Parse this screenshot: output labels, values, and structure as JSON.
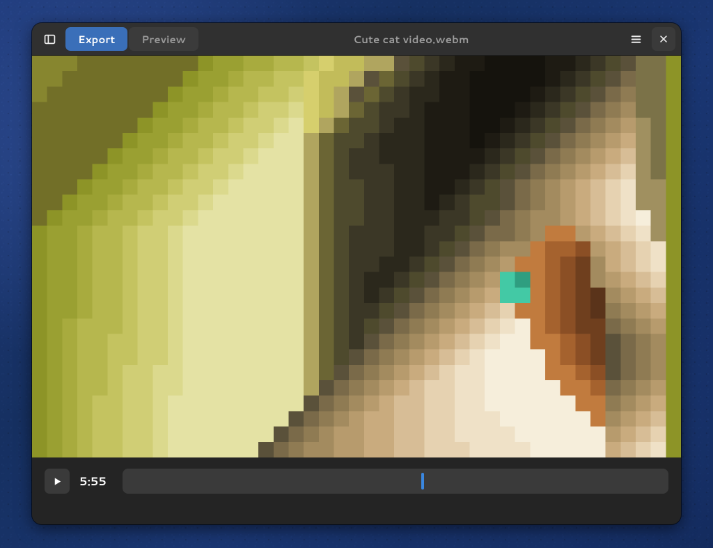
{
  "header": {
    "title": "Cute cat video.webm",
    "export_label": "Export",
    "preview_label": "Preview",
    "active_tab": "export"
  },
  "playback": {
    "time_label": "5:55",
    "progress_percent": 55
  },
  "icons": {
    "sidebar": "sidebar-toggle-icon",
    "menu": "hamburger-menu-icon",
    "close": "close-icon",
    "play": "play-icon"
  },
  "pixel_art": {
    "description": "pixelated tabby cat facing left on yellow-green bokeh background",
    "cols": 43,
    "rows": 26,
    "palette": {
      "A": "#8d9427",
      "B": "#9aa032",
      "C": "#a8ab3e",
      "D": "#b6b74e",
      "E": "#c4c360",
      "F": "#d0ce75",
      "G": "#dbd98d",
      "H": "#e4e2a4",
      "I": "#b0a55f",
      "J": "#6b6534",
      "K": "#4e4a2d",
      "L": "#3b3726",
      "M": "#2b281c",
      "N": "#1e1b13",
      "O": "#15130d",
      "P": "#5a513a",
      "Q": "#7a6a49",
      "R": "#8f7b53",
      "S": "#a38b5f",
      "T": "#b79b6d",
      "U": "#c9ab7e",
      "V": "#d7bd96",
      "W": "#e6d2b1",
      "X": "#efe1c7",
      "Y": "#f6eedb",
      "Z": "#c17b3e",
      "a": "#a5622e",
      "b": "#8b4f25",
      "c": "#6f3f1e",
      "d": "#5a331a",
      "e": "#43c9a5",
      "f": "#2f9e80",
      "g": "#d6cf6d",
      "h": "#c2bc5a",
      "i": "#5e5a30",
      "j": "#49462b",
      "k": "#383522",
      "l": "#9c9a40",
      "m": "#87862f",
      "n": "#726f28",
      "o": "#a09060",
      "p": "#7b7248"
    },
    "rows_data": [
      "mmmnnnnnnnnABBCCDDEghhIIPKLMNNOOOONNMLKPpp",
      "mmnnnnnnnnABBCDDEEghhIPJKLMNNOOOOONMLKPQpp",
      "mnnnnnnnnABBCDDEEFghIPJKLMMNNOOOONMLKPQRpp",
      "nnnnnnnnABBCDDEFFGghIJKLLMNNNOOONMLKPQRSpp",
      "nnnnnnnABBCDDEFFGHgIJKKLMMNNNOONMLKPQRSTop",
      "nnnnnnABBCDDEFFGHHIJKKLMMMNNNONMLKPQRSTUop",
      "nnnnnABBCDDEFFGHHHIJKLLMMMNNNNMLKPQRSTUVop",
      "nnnnABBCDDEFFGHHHHIJKLLLMMNNNMLKPQRSTUVWop",
      "nnnABBCDDEFFGHHHHHIJKKLLMMNNMLKPQRSTUVWXoo",
      "nnABBCDDEFFGHHHHHHIJKKLLMMNMLKKPQRSTUVWXoo",
      "nABBCDDEFFGHHHHHHHIJKKLLMMMLLKPQRSSTUVWXYo",
      "ABBCDDEFFGHHHHHHHHIJKLLLMMLLKPQQRSZZTUVWXo",
      "ABBCDDEFFGHHHHHHHHIJKLLLMMLKPQRSSZaabTUVWX",
      "ABBCDDEFFGHHHHHHHHIJKLLMMLKPQRSTZZabcSUVWX",
      "ABBCDDEFFGHHHHHHHHIJKLMMLKPQRSTefZabcSTUVW",
      "ABBCDDEFFGHHHHHHHHIJKLMLKPQRSTUeeZabcdSTUV",
      "ABBCDDEFFGHHHHHHHHIJKLLKPQRSTUVWZZabcdRSTU",
      "ABCDDDEFFGHHHHHHHHIJKLKPQRSTUVWXYZabccQRST",
      "ABCDDEEFFGHHHHHHHHIJKLPQRSTUVWXYYZZabcPQRS",
      "ABCDDEEFFGHHHHHHHHIJKPQRSTUVWXYYYYZabcPQRS",
      "ABCDDEFFGGHHHHHHHHIJPQRSTUVWXXYYYYZZabPQRS",
      "ABCDDEFFGGHHHHHHHHIPQRSTUVWWXXYYYYYZZaQRST",
      "ABCDEEFFGHHHHHHHHHPQRSTUVVWWXXYYYYYYZZRSTU",
      "ABCDEEFFGHHHHHHHHPQRSTUUVVWWXXXYYYYYYZSTUV",
      "ABCDEEFFGHHHHHHHPQRSTTUUVVWWXXXXYYYYYYTUVW",
      "ABCDEEFFGHHHHHHPQRSSTTUUVVWWWXXXXYYYYYUVWX"
    ]
  }
}
